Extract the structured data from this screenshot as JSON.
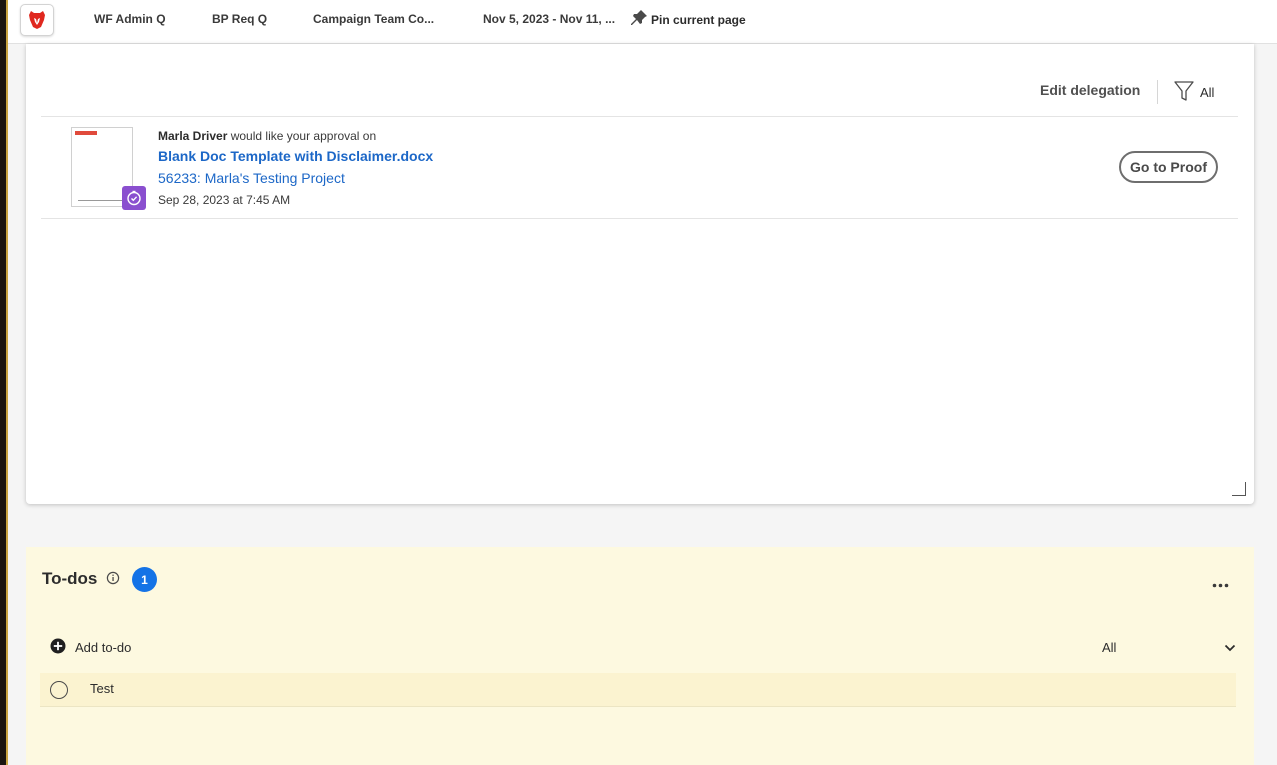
{
  "topbar": {
    "pinned_tabs": [
      {
        "label": "WF Admin Q"
      },
      {
        "label": "BP Req Q"
      },
      {
        "label": "Campaign Team Co..."
      },
      {
        "label": "Nov 5, 2023 - Nov 11, ..."
      }
    ],
    "pin_current_label": "Pin current page"
  },
  "approvals": {
    "edit_delegation_label": "Edit delegation",
    "filter_label": "All",
    "items": [
      {
        "requester": "Marla Driver",
        "request_text": "would like your approval on",
        "document": "Blank Doc Template with Disclaimer.docx",
        "project": "56233: Marla's Testing Project",
        "date": "Sep 28, 2023 at 7:45 AM",
        "action_label": "Go to Proof"
      }
    ]
  },
  "todos": {
    "title": "To-dos",
    "count": "1",
    "add_label": "Add to-do",
    "filter_value": "All",
    "items": [
      {
        "text": "Test",
        "done": false
      }
    ]
  },
  "colors": {
    "accent_blue": "#1473e6",
    "link_blue": "#1c67c7",
    "todos_bg": "#fdf9e0",
    "badge_purple": "#8a4fcf",
    "brand_red": "#e0281f"
  },
  "icons": {
    "logo": "brave-lion-logo-icon",
    "pin": "pushpin-icon",
    "filter": "funnel-filter-icon",
    "proof_badge": "proof-timer-icon",
    "info": "info-icon",
    "more": "more-horizontal-icon",
    "add": "add-circle-icon",
    "dropdown": "chevron-down-icon"
  }
}
